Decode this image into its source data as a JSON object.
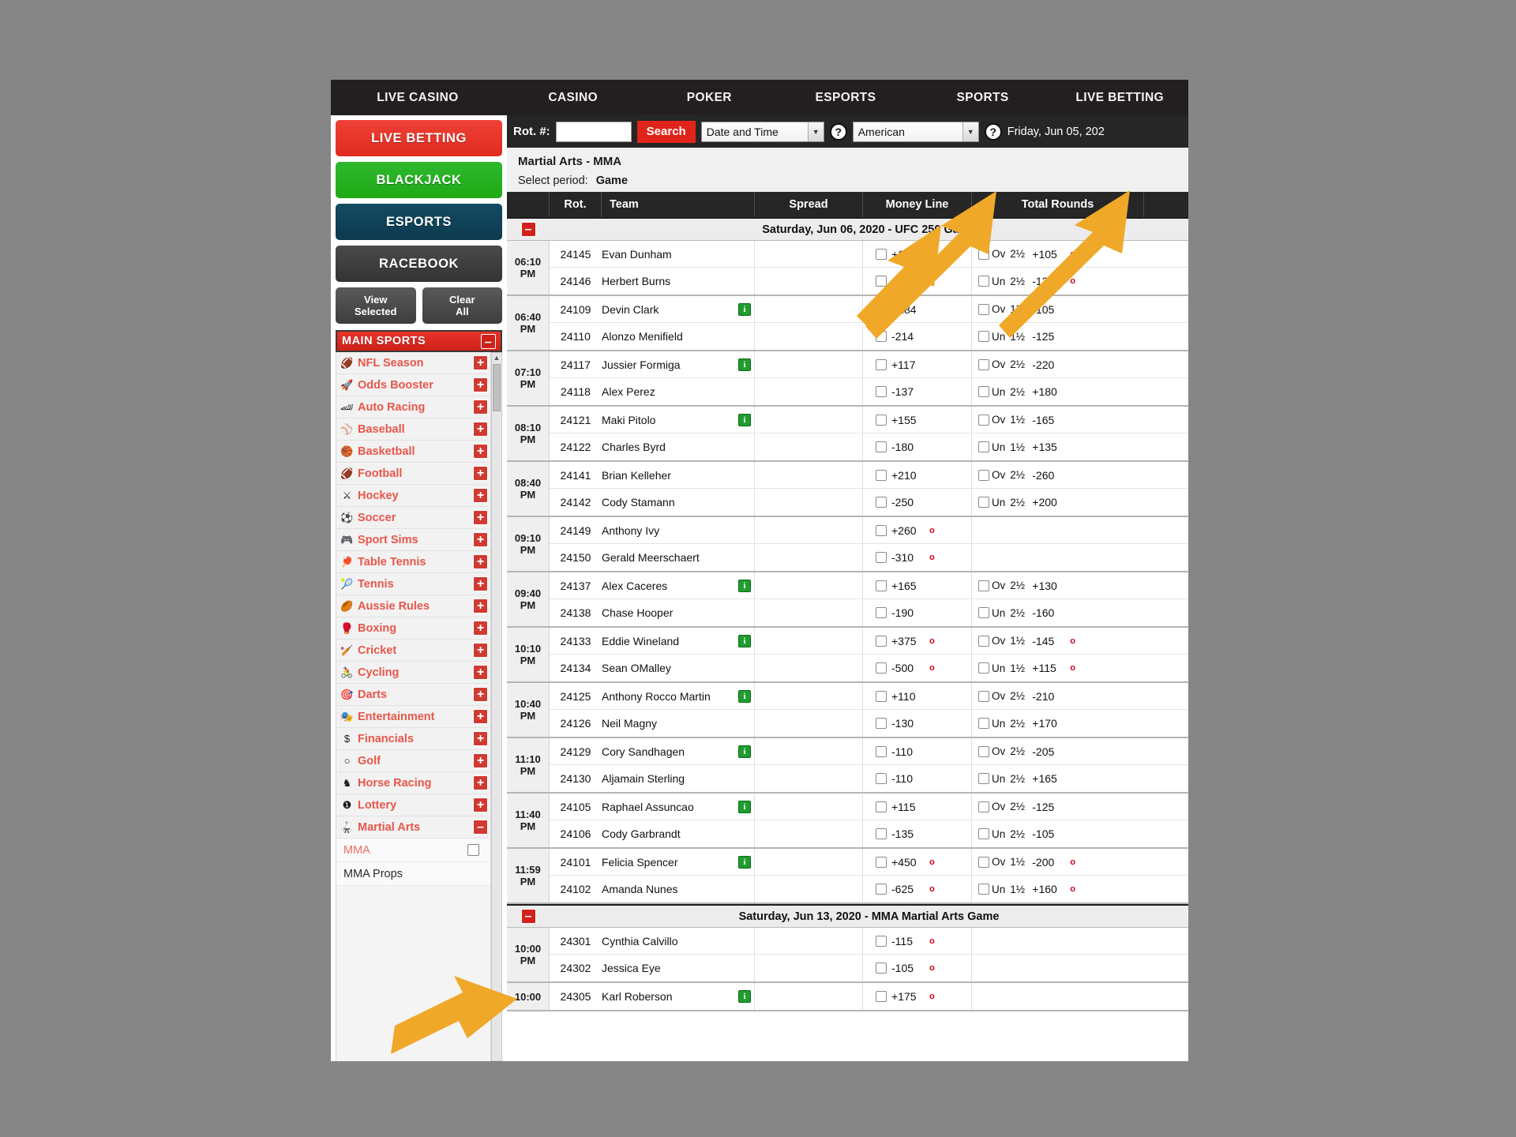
{
  "topnav": {
    "tabs": [
      {
        "label": "LIVE CASINO"
      },
      {
        "label": "CASINO"
      },
      {
        "label": "POKER"
      },
      {
        "label": "ESPORTS"
      },
      {
        "label": "SPORTS"
      },
      {
        "label": "LIVE BETTING"
      }
    ]
  },
  "sidebar": {
    "buttons": [
      {
        "label": "LIVE BETTING"
      },
      {
        "label": "BLACKJACK"
      },
      {
        "label": "ESPORTS"
      },
      {
        "label": "RACEBOOK"
      }
    ],
    "view_selected": "View\nSelected",
    "view_selected_l1": "View",
    "view_selected_l2": "Selected",
    "clear_all_l1": "Clear",
    "clear_all_l2": "All",
    "main_sports_label": "MAIN SPORTS",
    "main_sports_toggle": "–",
    "sports": [
      {
        "label": "NFL Season",
        "icon": "football-icon",
        "glyph": "🏈",
        "toggle": "+"
      },
      {
        "label": "Odds Booster",
        "icon": "rocket-icon",
        "glyph": "🚀",
        "toggle": "+"
      },
      {
        "label": "Auto Racing",
        "icon": "car-icon",
        "glyph": "🏎",
        "toggle": "+"
      },
      {
        "label": "Baseball",
        "icon": "baseball-icon",
        "glyph": "⚾",
        "toggle": "+"
      },
      {
        "label": "Basketball",
        "icon": "basketball-icon",
        "glyph": "🏀",
        "toggle": "+"
      },
      {
        "label": "Football",
        "icon": "football-icon",
        "glyph": "🏈",
        "toggle": "+"
      },
      {
        "label": "Hockey",
        "icon": "hockey-icon",
        "glyph": "⚔",
        "toggle": "+"
      },
      {
        "label": "Soccer",
        "icon": "soccer-icon",
        "glyph": "⚽",
        "toggle": "+"
      },
      {
        "label": "Sport Sims",
        "icon": "gamepad-icon",
        "glyph": "🎮",
        "toggle": "+"
      },
      {
        "label": "Table Tennis",
        "icon": "paddle-icon",
        "glyph": "🏓",
        "toggle": "+"
      },
      {
        "label": "Tennis",
        "icon": "tennis-icon",
        "glyph": "🎾",
        "toggle": "+"
      },
      {
        "label": "Aussie Rules",
        "icon": "aussie-ball-icon",
        "glyph": "🏉",
        "toggle": "+"
      },
      {
        "label": "Boxing",
        "icon": "boxing-glove-icon",
        "glyph": "🥊",
        "toggle": "+"
      },
      {
        "label": "Cricket",
        "icon": "cricket-bat-icon",
        "glyph": "🏏",
        "toggle": "+"
      },
      {
        "label": "Cycling",
        "icon": "bicycle-icon",
        "glyph": "🚴",
        "toggle": "+"
      },
      {
        "label": "Darts",
        "icon": "dart-icon",
        "glyph": "🎯",
        "toggle": "+"
      },
      {
        "label": "Entertainment",
        "icon": "masks-icon",
        "glyph": "🎭",
        "toggle": "+"
      },
      {
        "label": "Financials",
        "icon": "dollar-icon",
        "glyph": "$",
        "toggle": "+"
      },
      {
        "label": "Golf",
        "icon": "golf-ball-icon",
        "glyph": "○",
        "toggle": "+"
      },
      {
        "label": "Horse Racing",
        "icon": "horse-icon",
        "glyph": "♞",
        "toggle": "+"
      },
      {
        "label": "Lottery",
        "icon": "lottery-ball-icon",
        "glyph": "❶",
        "toggle": "+"
      },
      {
        "label": "Martial Arts",
        "icon": "martial-arts-icon",
        "glyph": "🥋",
        "toggle": "–"
      }
    ],
    "subitems": [
      {
        "label": "MMA",
        "checkbox": true
      },
      {
        "label": "MMA Props",
        "checkbox": false
      }
    ]
  },
  "search": {
    "rot_label": "Rot. #:",
    "rot_value": "",
    "rot_placeholder": "",
    "search_button": "Search",
    "sort_select": "Date and Time",
    "odds_select": "American",
    "help": "?",
    "date_display": "Friday, Jun 05, 202"
  },
  "breadcrumb": {
    "sport": "Martial Arts - MMA",
    "period_label": "Select period:",
    "period_value": "Game"
  },
  "table": {
    "headers": [
      "",
      "Rot.",
      "Team",
      "Spread",
      "Money Line",
      "Total Rounds"
    ],
    "groups": [
      {
        "date_header": "Saturday, Jun 06, 2020 - UFC 250 Game",
        "toggle": "–",
        "games": [
          {
            "time1": "06:10",
            "time2": "PM",
            "fighters": [
              {
                "rot": "24145",
                "name": "Evan Dunham",
                "info": false,
                "spread": "",
                "ml": "+185",
                "ml_o": true,
                "ou": "Ov",
                "line": "2½",
                "tot": "+105",
                "tot_o": true
              },
              {
                "rot": "24146",
                "name": "Herbert Burns",
                "info": false,
                "spread": "",
                "ml": "-220",
                "ml_o": true,
                "ou": "Un",
                "line": "2½",
                "tot": "-135",
                "tot_o": true
              }
            ]
          },
          {
            "time1": "06:40",
            "time2": "PM",
            "fighters": [
              {
                "rot": "24109",
                "name": "Devin Clark",
                "info": true,
                "spread": "",
                "ml": "+184",
                "ml_o": false,
                "ou": "Ov",
                "line": "1½",
                "tot": "-105",
                "tot_o": false
              },
              {
                "rot": "24110",
                "name": "Alonzo Menifield",
                "info": false,
                "spread": "",
                "ml": "-214",
                "ml_o": false,
                "ou": "Un",
                "line": "1½",
                "tot": "-125",
                "tot_o": false
              }
            ]
          },
          {
            "time1": "07:10",
            "time2": "PM",
            "fighters": [
              {
                "rot": "24117",
                "name": "Jussier Formiga",
                "info": true,
                "spread": "",
                "ml": "+117",
                "ml_o": false,
                "ou": "Ov",
                "line": "2½",
                "tot": "-220",
                "tot_o": false
              },
              {
                "rot": "24118",
                "name": "Alex Perez",
                "info": false,
                "spread": "",
                "ml": "-137",
                "ml_o": false,
                "ou": "Un",
                "line": "2½",
                "tot": "+180",
                "tot_o": false
              }
            ]
          },
          {
            "time1": "08:10",
            "time2": "PM",
            "fighters": [
              {
                "rot": "24121",
                "name": "Maki Pitolo",
                "info": true,
                "spread": "",
                "ml": "+155",
                "ml_o": false,
                "ou": "Ov",
                "line": "1½",
                "tot": "-165",
                "tot_o": false
              },
              {
                "rot": "24122",
                "name": "Charles Byrd",
                "info": false,
                "spread": "",
                "ml": "-180",
                "ml_o": false,
                "ou": "Un",
                "line": "1½",
                "tot": "+135",
                "tot_o": false
              }
            ]
          },
          {
            "time1": "08:40",
            "time2": "PM",
            "fighters": [
              {
                "rot": "24141",
                "name": "Brian Kelleher",
                "info": false,
                "spread": "",
                "ml": "+210",
                "ml_o": false,
                "ou": "Ov",
                "line": "2½",
                "tot": "-260",
                "tot_o": false
              },
              {
                "rot": "24142",
                "name": "Cody Stamann",
                "info": false,
                "spread": "",
                "ml": "-250",
                "ml_o": false,
                "ou": "Un",
                "line": "2½",
                "tot": "+200",
                "tot_o": false
              }
            ]
          },
          {
            "time1": "09:10",
            "time2": "PM",
            "fighters": [
              {
                "rot": "24149",
                "name": "Anthony Ivy",
                "info": false,
                "spread": "",
                "ml": "+260",
                "ml_o": true,
                "ou": "",
                "line": "",
                "tot": "",
                "tot_o": false
              },
              {
                "rot": "24150",
                "name": "Gerald Meerschaert",
                "info": false,
                "spread": "",
                "ml": "-310",
                "ml_o": true,
                "ou": "",
                "line": "",
                "tot": "",
                "tot_o": false
              }
            ]
          },
          {
            "time1": "09:40",
            "time2": "PM",
            "fighters": [
              {
                "rot": "24137",
                "name": "Alex Caceres",
                "info": true,
                "spread": "",
                "ml": "+165",
                "ml_o": false,
                "ou": "Ov",
                "line": "2½",
                "tot": "+130",
                "tot_o": false
              },
              {
                "rot": "24138",
                "name": "Chase Hooper",
                "info": false,
                "spread": "",
                "ml": "-190",
                "ml_o": false,
                "ou": "Un",
                "line": "2½",
                "tot": "-160",
                "tot_o": false
              }
            ]
          },
          {
            "time1": "10:10",
            "time2": "PM",
            "fighters": [
              {
                "rot": "24133",
                "name": "Eddie Wineland",
                "info": true,
                "spread": "",
                "ml": "+375",
                "ml_o": true,
                "ou": "Ov",
                "line": "1½",
                "tot": "-145",
                "tot_o": true
              },
              {
                "rot": "24134",
                "name": "Sean OMalley",
                "info": false,
                "spread": "",
                "ml": "-500",
                "ml_o": true,
                "ou": "Un",
                "line": "1½",
                "tot": "+115",
                "tot_o": true
              }
            ]
          },
          {
            "time1": "10:40",
            "time2": "PM",
            "fighters": [
              {
                "rot": "24125",
                "name": "Anthony Rocco Martin",
                "info": true,
                "spread": "",
                "ml": "+110",
                "ml_o": false,
                "ou": "Ov",
                "line": "2½",
                "tot": "-210",
                "tot_o": false
              },
              {
                "rot": "24126",
                "name": "Neil Magny",
                "info": false,
                "spread": "",
                "ml": "-130",
                "ml_o": false,
                "ou": "Un",
                "line": "2½",
                "tot": "+170",
                "tot_o": false
              }
            ]
          },
          {
            "time1": "11:10",
            "time2": "PM",
            "fighters": [
              {
                "rot": "24129",
                "name": "Cory Sandhagen",
                "info": true,
                "spread": "",
                "ml": "-110",
                "ml_o": false,
                "ou": "Ov",
                "line": "2½",
                "tot": "-205",
                "tot_o": false
              },
              {
                "rot": "24130",
                "name": "Aljamain Sterling",
                "info": false,
                "spread": "",
                "ml": "-110",
                "ml_o": false,
                "ou": "Un",
                "line": "2½",
                "tot": "+165",
                "tot_o": false
              }
            ]
          },
          {
            "time1": "11:40",
            "time2": "PM",
            "fighters": [
              {
                "rot": "24105",
                "name": "Raphael Assuncao",
                "info": true,
                "spread": "",
                "ml": "+115",
                "ml_o": false,
                "ou": "Ov",
                "line": "2½",
                "tot": "-125",
                "tot_o": false
              },
              {
                "rot": "24106",
                "name": "Cody Garbrandt",
                "info": false,
                "spread": "",
                "ml": "-135",
                "ml_o": false,
                "ou": "Un",
                "line": "2½",
                "tot": "-105",
                "tot_o": false
              }
            ]
          },
          {
            "time1": "11:59",
            "time2": "PM",
            "fighters": [
              {
                "rot": "24101",
                "name": "Felicia Spencer",
                "info": true,
                "spread": "",
                "ml": "+450",
                "ml_o": true,
                "ou": "Ov",
                "line": "1½",
                "tot": "-200",
                "tot_o": true
              },
              {
                "rot": "24102",
                "name": "Amanda Nunes",
                "info": false,
                "spread": "",
                "ml": "-625",
                "ml_o": true,
                "ou": "Un",
                "line": "1½",
                "tot": "+160",
                "tot_o": true
              }
            ]
          }
        ]
      },
      {
        "date_header": "Saturday, Jun 13, 2020 - MMA Martial Arts Game",
        "toggle": "–",
        "games": [
          {
            "time1": "10:00",
            "time2": "PM",
            "fighters": [
              {
                "rot": "24301",
                "name": "Cynthia Calvillo",
                "info": false,
                "spread": "",
                "ml": "-115",
                "ml_o": true,
                "ou": "",
                "line": "",
                "tot": "",
                "tot_o": false
              },
              {
                "rot": "24302",
                "name": "Jessica Eye",
                "info": false,
                "spread": "",
                "ml": "-105",
                "ml_o": true,
                "ou": "",
                "line": "",
                "tot": "",
                "tot_o": false
              }
            ]
          },
          {
            "time1": "10:00",
            "time2": "",
            "fighters": [
              {
                "rot": "24305",
                "name": "Karl Roberson",
                "info": true,
                "spread": "",
                "ml": "+175",
                "ml_o": true,
                "ou": "",
                "line": "",
                "tot": "",
                "tot_o": false
              }
            ]
          }
        ]
      }
    ]
  },
  "annotations": {
    "arrow_color": "#f0a828",
    "arrows": [
      {
        "name": "arrow-to-sports-tab"
      },
      {
        "name": "arrow-to-money-line"
      },
      {
        "name": "arrow-to-total-rounds"
      },
      {
        "name": "arrow-to-mma-checkbox"
      }
    ]
  }
}
